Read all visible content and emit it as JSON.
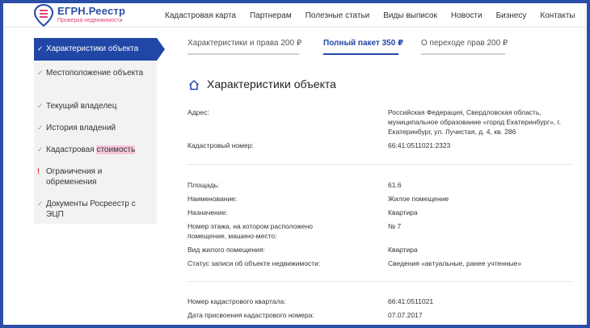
{
  "logo": {
    "title": "ЕГРН.Реестр",
    "subtitle": "Проверка недвижимости"
  },
  "nav": [
    "Кадастровая карта",
    "Партнерам",
    "Полезные статьи",
    "Виды выписок",
    "Новости",
    "Бизнесу",
    "Контакты"
  ],
  "sidebar": {
    "active": "Характеристики объекта",
    "items": [
      {
        "label": "Местоположение объекта",
        "mark": "✓"
      },
      {
        "label": "Текущий владелец",
        "mark": "✓"
      },
      {
        "label": "История владений",
        "mark": "✓"
      },
      {
        "label_plain": "Кадастровая ",
        "label_highlight": "стоимость",
        "mark": "✓"
      },
      {
        "label": "Ограничения и обременения",
        "mark": "!"
      },
      {
        "label": "Документы Росреестр с ЭЦП",
        "mark": "✓"
      }
    ]
  },
  "tabs": [
    {
      "label": "Характеристики и права 200 ₽",
      "active": false
    },
    {
      "label": "Полный пакет 350 ₽",
      "active": true
    },
    {
      "label": "О переходе прав 200 ₽",
      "active": false
    }
  ],
  "main": {
    "title": "Характеристики объекта",
    "rows": [
      {
        "label": "Адрес:",
        "value": "Российская Федерация, Свердловская область, муниципальное образование «город Екатеринбург», г. Екатеринбург, ул. Лучистая, д. 4, кв. 286"
      },
      {
        "label": "Кадастровый номер:",
        "value": "66:41:0511021:2323"
      },
      {
        "label": "Площадь:",
        "value": "61.6"
      },
      {
        "label": "Наименование:",
        "value": "Жилое помещение"
      },
      {
        "label": "Назначение:",
        "value": "Квартира"
      },
      {
        "label": "Номер этажа, на котором расположено помещение, машино-место:",
        "value": "№ 7"
      },
      {
        "label": "Вид жилого помещения:",
        "value": "Квартира"
      },
      {
        "label": "Статус записи об объекте недвижимости:",
        "value": "Сведения «актуальные, ранее учтенные»"
      },
      {
        "label": "Номер кадастрового квартала:",
        "value": "66:41:0511021"
      },
      {
        "label": "Дата присвоения кадастрового номера:",
        "value": "07.07.2017"
      }
    ]
  },
  "colors": {
    "brand_blue": "#2147a6",
    "frame": "#2b4fa6",
    "accent_pink": "#e0457b",
    "sidebar_bg": "#f2f2f2"
  }
}
